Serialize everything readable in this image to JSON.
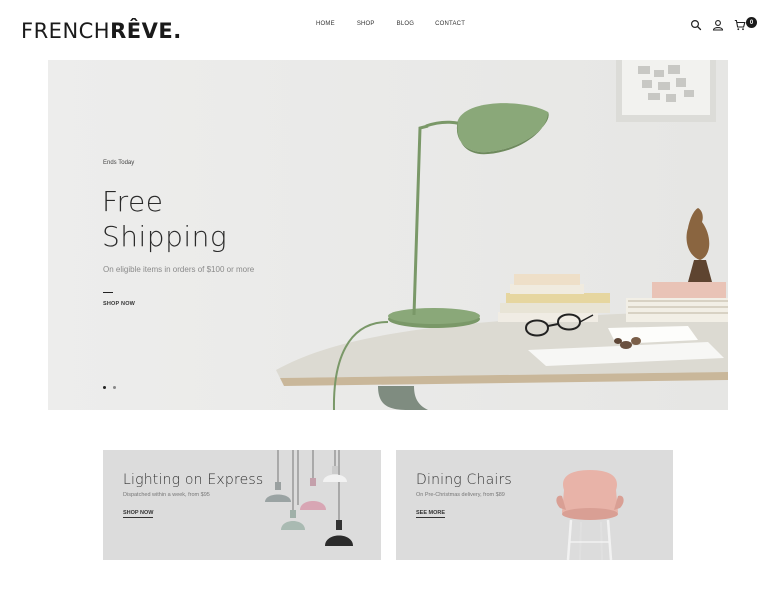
{
  "brand": {
    "name_light": "FRENCH",
    "name_bold": "RÊVE",
    "dot": "."
  },
  "nav": [
    {
      "label": "HOME"
    },
    {
      "label": "SHOP"
    },
    {
      "label": "BLOG"
    },
    {
      "label": "CONTACT"
    }
  ],
  "header_icons": {
    "search": "search-icon",
    "account": "user-icon",
    "cart": "cart-icon",
    "cart_count": "0"
  },
  "hero": {
    "eyebrow": "Ends Today",
    "title_line1": "Free",
    "title_line2": "Shipping",
    "subtitle": "On eligible items in orders of $100 or more",
    "cta": "SHOP NOW",
    "slides": 2,
    "active_slide": 1
  },
  "promos": [
    {
      "title": "Lighting on Express",
      "subtitle": "Dispatched within a week, from $95",
      "cta": "SHOP NOW"
    },
    {
      "title": "Dining Chairs",
      "subtitle": "On Pre-Christmas delivery, from $89",
      "cta": "SEE MORE"
    }
  ],
  "colors": {
    "hero_bg": "#ebebea",
    "card_bg": "#dcdcdc",
    "lamp_green": "#7a9868",
    "chair_pink": "#e8b3a8"
  }
}
